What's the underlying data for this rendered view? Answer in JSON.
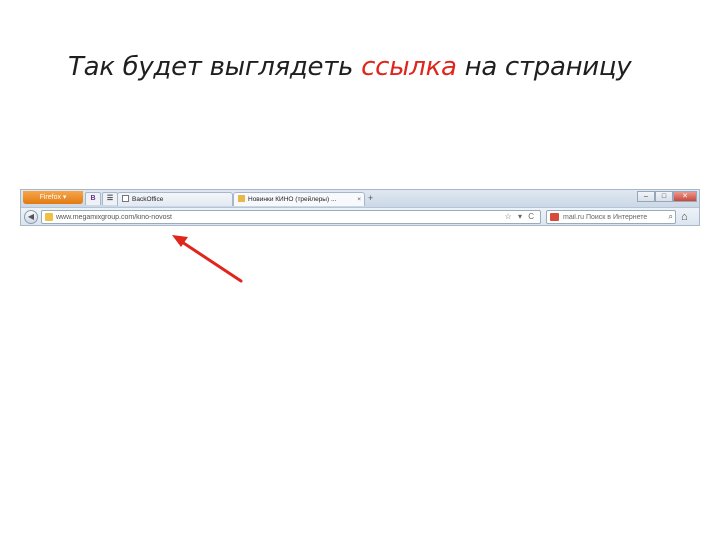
{
  "slide": {
    "title_before": "Так будет выглядеть ",
    "title_accent": "ссылка",
    "title_after": " на страницу",
    "accent_color": "#e0261c"
  },
  "browser": {
    "menu_button": "Firefox ▾",
    "app_tab_label": "B",
    "tabs": [
      {
        "label": "BackOffice",
        "icon": "page-icon"
      },
      {
        "label": "Новинки КИНО (трейлеры) ...",
        "icon": "folder-icon"
      }
    ],
    "new_tab": "+",
    "window_controls": [
      "–",
      "□",
      "✕"
    ],
    "url": "www.megamixgroup.com/kino-novost",
    "url_controls": "☆ ▾ C",
    "search_text": "mail.ru Поиск в Интернете",
    "home": "⌂"
  }
}
